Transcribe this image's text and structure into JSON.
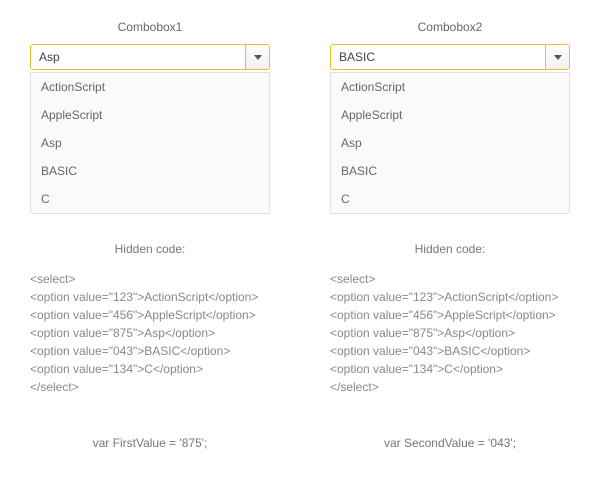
{
  "left": {
    "title": "Combobox1",
    "input_value": "Asp",
    "dropdown": [
      "ActionScript",
      "AppleScript",
      "Asp",
      "BASIC",
      "C"
    ],
    "hidden_label": "Hidden code:",
    "code": "<select>\n<option value=\"123\">ActionScript</option>\n<option value=\"456\">AppleScript</option>\n<option value=\"875\">Asp</option>\n<option value=\"043\">BASIC</option>\n<option value=\"134\">C</option>\n</select>",
    "var_line": "var FirstValue = '875';"
  },
  "right": {
    "title": "Combobox2",
    "input_value": "BASIC",
    "dropdown": [
      "ActionScript",
      "AppleScript",
      "Asp",
      "BASIC",
      "C"
    ],
    "hidden_label": "Hidden code:",
    "code": "<select>\n<option value=\"123\">ActionScript</option>\n<option value=\"456\">AppleScript</option>\n<option value=\"875\">Asp</option>\n<option value=\"043\">BASIC</option>\n<option value=\"134\">C</option>\n</select>",
    "var_line": "var SecondValue = '043';"
  }
}
